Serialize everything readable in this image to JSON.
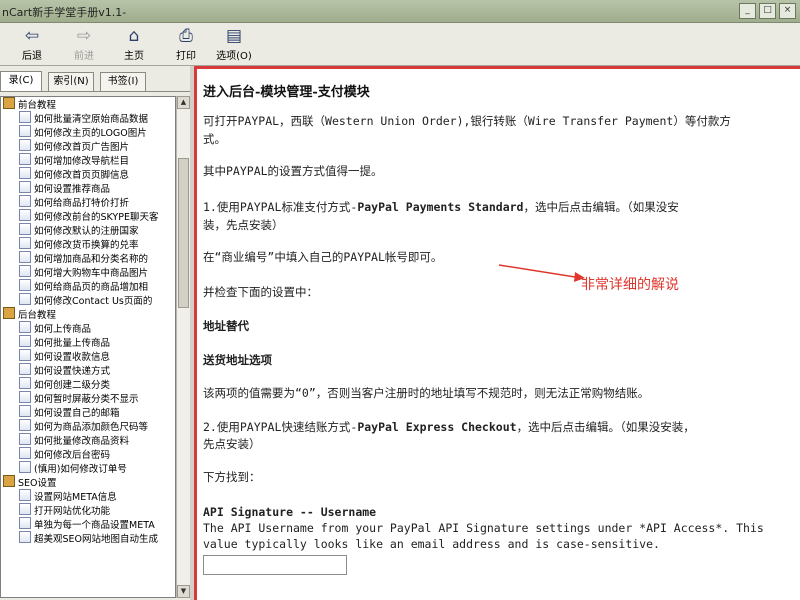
{
  "window": {
    "title": "nCart新手学堂手册v1.1-",
    "controls": [
      "_",
      "□",
      "×"
    ]
  },
  "toolbar": {
    "buttons": [
      {
        "label": "后退",
        "icon": "back-arrow-icon",
        "glyph": "⇦",
        "enabled": true
      },
      {
        "label": "前进",
        "icon": "forward-arrow-icon",
        "glyph": "⇨",
        "enabled": false
      },
      {
        "label": "主页",
        "icon": "home-icon",
        "glyph": "⌂",
        "enabled": true
      },
      {
        "label": "打印",
        "icon": "printer-icon",
        "glyph": "⎙",
        "enabled": true
      },
      {
        "label": "选项(O)",
        "icon": "options-icon",
        "glyph": "▤",
        "enabled": true
      }
    ]
  },
  "nav": {
    "tabs": [
      "录(C)",
      "索引(N)",
      "书签(I)"
    ],
    "active_tab": 0,
    "tree": [
      {
        "type": "folder",
        "label": "前台教程"
      },
      {
        "type": "item",
        "label": "如何批量清空原始商品数据"
      },
      {
        "type": "item",
        "label": "如何修改主页的LOGO图片"
      },
      {
        "type": "item",
        "label": "如何修改首页广告图片"
      },
      {
        "type": "item",
        "label": "如何增加修改导航栏目"
      },
      {
        "type": "item",
        "label": "如何修改首页页脚信息"
      },
      {
        "type": "item",
        "label": "如何设置推荐商品"
      },
      {
        "type": "item",
        "label": "如何给商品打特价打折"
      },
      {
        "type": "item",
        "label": "如何修改前台的SKYPE聊天客"
      },
      {
        "type": "item",
        "label": "如何修改默认的注册国家"
      },
      {
        "type": "item",
        "label": "如何修改货币换算的兑率"
      },
      {
        "type": "item",
        "label": "如何增加商品和分类名称的"
      },
      {
        "type": "item",
        "label": "如何增大购物车中商品图片"
      },
      {
        "type": "item",
        "label": "如何给商品页的商品增加相"
      },
      {
        "type": "item",
        "label": "如何修改Contact Us页面的"
      },
      {
        "type": "folder",
        "label": "后台教程"
      },
      {
        "type": "item",
        "label": "如何上传商品"
      },
      {
        "type": "item",
        "label": "如何批量上传商品"
      },
      {
        "type": "item",
        "label": "如何设置收款信息"
      },
      {
        "type": "item",
        "label": "如何设置快递方式"
      },
      {
        "type": "item",
        "label": "如何创建二级分类"
      },
      {
        "type": "item",
        "label": "如何暂时屏蔽分类不显示"
      },
      {
        "type": "item",
        "label": "如何设置自己的邮箱"
      },
      {
        "type": "item",
        "label": "如何为商品添加颜色尺码等"
      },
      {
        "type": "item",
        "label": "如何批量修改商品资料"
      },
      {
        "type": "item",
        "label": "如何修改后台密码"
      },
      {
        "type": "item",
        "label": "(慎用)如何修改订单号"
      },
      {
        "type": "folder",
        "label": "SEO设置"
      },
      {
        "type": "item",
        "label": "设置网站META信息"
      },
      {
        "type": "item",
        "label": "打开网站优化功能"
      },
      {
        "type": "item",
        "label": "单独为每一个商品设置META"
      },
      {
        "type": "item",
        "label": "超美观SEO网站地图自动生成"
      }
    ],
    "scroll_position": 0.15
  },
  "content": {
    "heading": "进入后台-模块管理-支付模块",
    "p1_line1": "可打开PAYPAL，西联（Western Union Order),银行转账（Wire Transfer Payment）等付款方",
    "p1_line2": "式。",
    "p2": "其中PAYPAL的设置方式值得一提。",
    "step1_prefix": "1.使用PAYPAL标准支付方式-",
    "step1_bold": "PayPal Payments Standard",
    "step1_suffix": "，选中后点击编辑。（如果没安",
    "step1_line2": "装，先点安装）",
    "p3": "在“商业编号”中填入自己的PAYPAL帐号即可。",
    "p4": "并检查下面的设置中：",
    "h2": "地址替代",
    "h3": "送货地址选项",
    "p5": "该两项的值需要为“0”，否则当客户注册时的地址填写不规范时，则无法正常购物结账。",
    "step2_prefix": "2.使用PAYPAL快速结账方式-",
    "step2_bold": "PayPal Express Checkout",
    "step2_suffix": "，选中后点击编辑。（如果没安装，",
    "step2_line2": "先点安装）",
    "p6": "下方找到：",
    "api_title": "API Signature -- Username",
    "api_desc_line1": "The API Username from your PayPal API Signature settings under *API Access*. This",
    "api_desc_line2": "value typically looks like an email address and is case-sensitive.",
    "username_value": "",
    "annotation": "非常详细的解说",
    "annotation_color": "#e0362c",
    "frame_color": "#d63a3a"
  }
}
